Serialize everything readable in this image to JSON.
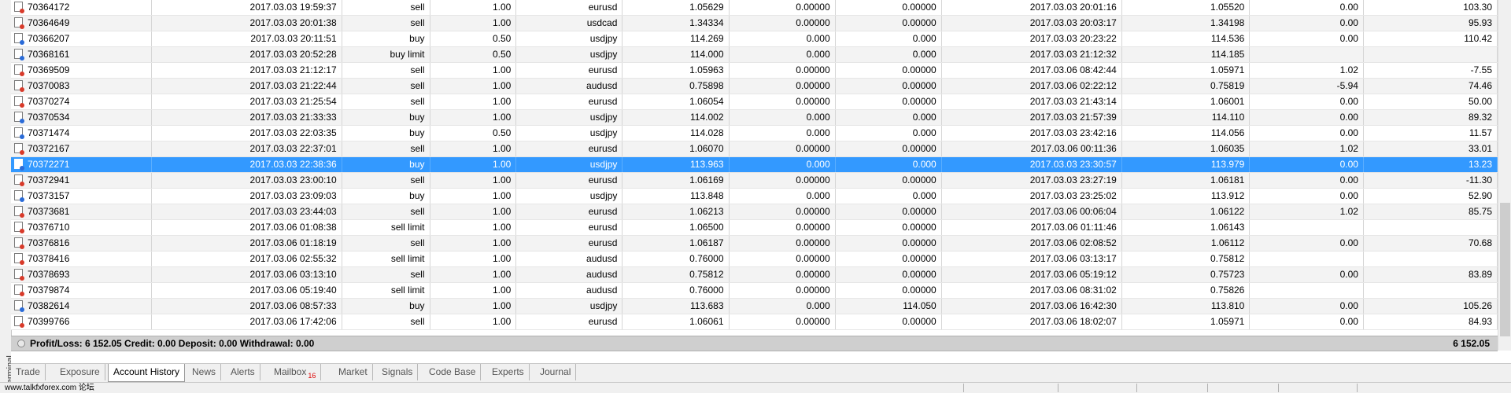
{
  "terminal_label": "Terminal",
  "rows": [
    {
      "ticket": "70364172",
      "open_time": "2017.03.03 19:59:37",
      "type": "sell",
      "size": "1.00",
      "item": "eurusd",
      "price": "1.05629",
      "sl": "0.00000",
      "tp": "0.00000",
      "close_time": "2017.03.03 20:01:16",
      "close_price": "1.05520",
      "swap": "0.00",
      "profit": "103.30"
    },
    {
      "ticket": "70364649",
      "open_time": "2017.03.03 20:01:38",
      "type": "sell",
      "size": "1.00",
      "item": "usdcad",
      "price": "1.34334",
      "sl": "0.00000",
      "tp": "0.00000",
      "close_time": "2017.03.03 20:03:17",
      "close_price": "1.34198",
      "swap": "0.00",
      "profit": "95.93"
    },
    {
      "ticket": "70366207",
      "open_time": "2017.03.03 20:11:51",
      "type": "buy",
      "size": "0.50",
      "item": "usdjpy",
      "price": "114.269",
      "sl": "0.000",
      "tp": "0.000",
      "close_time": "2017.03.03 20:23:22",
      "close_price": "114.536",
      "swap": "0.00",
      "profit": "110.42"
    },
    {
      "ticket": "70368161",
      "open_time": "2017.03.03 20:52:28",
      "type": "buy limit",
      "size": "0.50",
      "item": "usdjpy",
      "price": "114.000",
      "sl": "0.000",
      "tp": "0.000",
      "close_time": "2017.03.03 21:12:32",
      "close_price": "114.185",
      "swap": "",
      "profit": ""
    },
    {
      "ticket": "70369509",
      "open_time": "2017.03.03 21:12:17",
      "type": "sell",
      "size": "1.00",
      "item": "eurusd",
      "price": "1.05963",
      "sl": "0.00000",
      "tp": "0.00000",
      "close_time": "2017.03.06 08:42:44",
      "close_price": "1.05971",
      "swap": "1.02",
      "profit": "-7.55"
    },
    {
      "ticket": "70370083",
      "open_time": "2017.03.03 21:22:44",
      "type": "sell",
      "size": "1.00",
      "item": "audusd",
      "price": "0.75898",
      "sl": "0.00000",
      "tp": "0.00000",
      "close_time": "2017.03.06 02:22:12",
      "close_price": "0.75819",
      "swap": "-5.94",
      "profit": "74.46"
    },
    {
      "ticket": "70370274",
      "open_time": "2017.03.03 21:25:54",
      "type": "sell",
      "size": "1.00",
      "item": "eurusd",
      "price": "1.06054",
      "sl": "0.00000",
      "tp": "0.00000",
      "close_time": "2017.03.03 21:43:14",
      "close_price": "1.06001",
      "swap": "0.00",
      "profit": "50.00"
    },
    {
      "ticket": "70370534",
      "open_time": "2017.03.03 21:33:33",
      "type": "buy",
      "size": "1.00",
      "item": "usdjpy",
      "price": "114.002",
      "sl": "0.000",
      "tp": "0.000",
      "close_time": "2017.03.03 21:57:39",
      "close_price": "114.110",
      "swap": "0.00",
      "profit": "89.32"
    },
    {
      "ticket": "70371474",
      "open_time": "2017.03.03 22:03:35",
      "type": "buy",
      "size": "0.50",
      "item": "usdjpy",
      "price": "114.028",
      "sl": "0.000",
      "tp": "0.000",
      "close_time": "2017.03.03 23:42:16",
      "close_price": "114.056",
      "swap": "0.00",
      "profit": "11.57"
    },
    {
      "ticket": "70372167",
      "open_time": "2017.03.03 22:37:01",
      "type": "sell",
      "size": "1.00",
      "item": "eurusd",
      "price": "1.06070",
      "sl": "0.00000",
      "tp": "0.00000",
      "close_time": "2017.03.06 00:11:36",
      "close_price": "1.06035",
      "swap": "1.02",
      "profit": "33.01"
    },
    {
      "ticket": "70372271",
      "open_time": "2017.03.03 22:38:36",
      "type": "buy",
      "size": "1.00",
      "item": "usdjpy",
      "price": "113.963",
      "sl": "0.000",
      "tp": "0.000",
      "close_time": "2017.03.03 23:30:57",
      "close_price": "113.979",
      "swap": "0.00",
      "profit": "13.23",
      "selected": true
    },
    {
      "ticket": "70372941",
      "open_time": "2017.03.03 23:00:10",
      "type": "sell",
      "size": "1.00",
      "item": "eurusd",
      "price": "1.06169",
      "sl": "0.00000",
      "tp": "0.00000",
      "close_time": "2017.03.03 23:27:19",
      "close_price": "1.06181",
      "swap": "0.00",
      "profit": "-11.30"
    },
    {
      "ticket": "70373157",
      "open_time": "2017.03.03 23:09:03",
      "type": "buy",
      "size": "1.00",
      "item": "usdjpy",
      "price": "113.848",
      "sl": "0.000",
      "tp": "0.000",
      "close_time": "2017.03.03 23:25:02",
      "close_price": "113.912",
      "swap": "0.00",
      "profit": "52.90"
    },
    {
      "ticket": "70373681",
      "open_time": "2017.03.03 23:44:03",
      "type": "sell",
      "size": "1.00",
      "item": "eurusd",
      "price": "1.06213",
      "sl": "0.00000",
      "tp": "0.00000",
      "close_time": "2017.03.06 00:06:04",
      "close_price": "1.06122",
      "swap": "1.02",
      "profit": "85.75"
    },
    {
      "ticket": "70376710",
      "open_time": "2017.03.06 01:08:38",
      "type": "sell limit",
      "size": "1.00",
      "item": "eurusd",
      "price": "1.06500",
      "sl": "0.00000",
      "tp": "0.00000",
      "close_time": "2017.03.06 01:11:46",
      "close_price": "1.06143",
      "swap": "",
      "profit": ""
    },
    {
      "ticket": "70376816",
      "open_time": "2017.03.06 01:18:19",
      "type": "sell",
      "size": "1.00",
      "item": "eurusd",
      "price": "1.06187",
      "sl": "0.00000",
      "tp": "0.00000",
      "close_time": "2017.03.06 02:08:52",
      "close_price": "1.06112",
      "swap": "0.00",
      "profit": "70.68"
    },
    {
      "ticket": "70378416",
      "open_time": "2017.03.06 02:55:32",
      "type": "sell limit",
      "size": "1.00",
      "item": "audusd",
      "price": "0.76000",
      "sl": "0.00000",
      "tp": "0.00000",
      "close_time": "2017.03.06 03:13:17",
      "close_price": "0.75812",
      "swap": "",
      "profit": ""
    },
    {
      "ticket": "70378693",
      "open_time": "2017.03.06 03:13:10",
      "type": "sell",
      "size": "1.00",
      "item": "audusd",
      "price": "0.75812",
      "sl": "0.00000",
      "tp": "0.00000",
      "close_time": "2017.03.06 05:19:12",
      "close_price": "0.75723",
      "swap": "0.00",
      "profit": "83.89"
    },
    {
      "ticket": "70379874",
      "open_time": "2017.03.06 05:19:40",
      "type": "sell limit",
      "size": "1.00",
      "item": "audusd",
      "price": "0.76000",
      "sl": "0.00000",
      "tp": "0.00000",
      "close_time": "2017.03.06 08:31:02",
      "close_price": "0.75826",
      "swap": "",
      "profit": ""
    },
    {
      "ticket": "70382614",
      "open_time": "2017.03.06 08:57:33",
      "type": "buy",
      "size": "1.00",
      "item": "usdjpy",
      "price": "113.683",
      "sl": "0.000",
      "tp": "114.050",
      "close_time": "2017.03.06 16:42:30",
      "close_price": "113.810",
      "swap": "0.00",
      "profit": "105.26"
    },
    {
      "ticket": "70399766",
      "open_time": "2017.03.06 17:42:06",
      "type": "sell",
      "size": "1.00",
      "item": "eurusd",
      "price": "1.06061",
      "sl": "0.00000",
      "tp": "0.00000",
      "close_time": "2017.03.06 18:02:07",
      "close_price": "1.05971",
      "swap": "0.00",
      "profit": "84.93"
    }
  ],
  "summary": {
    "text": "Profit/Loss: 6 152.05  Credit: 0.00  Deposit: 0.00  Withdrawal: 0.00",
    "total": "6 152.05"
  },
  "tabs": [
    {
      "label": "Trade",
      "badge": ""
    },
    {
      "label": "Exposure",
      "badge": ""
    },
    {
      "label": "Account History",
      "badge": "",
      "active": true
    },
    {
      "label": "News",
      "badge": ""
    },
    {
      "label": "Alerts",
      "badge": ""
    },
    {
      "label": "Mailbox",
      "badge": "16"
    },
    {
      "label": "Market",
      "badge": ""
    },
    {
      "label": "Signals",
      "badge": ""
    },
    {
      "label": "Code Base",
      "badge": ""
    },
    {
      "label": "Experts",
      "badge": ""
    },
    {
      "label": "Journal",
      "badge": ""
    }
  ],
  "statusbar": {
    "watermark": "www.talkfxforex.com 论坛"
  }
}
